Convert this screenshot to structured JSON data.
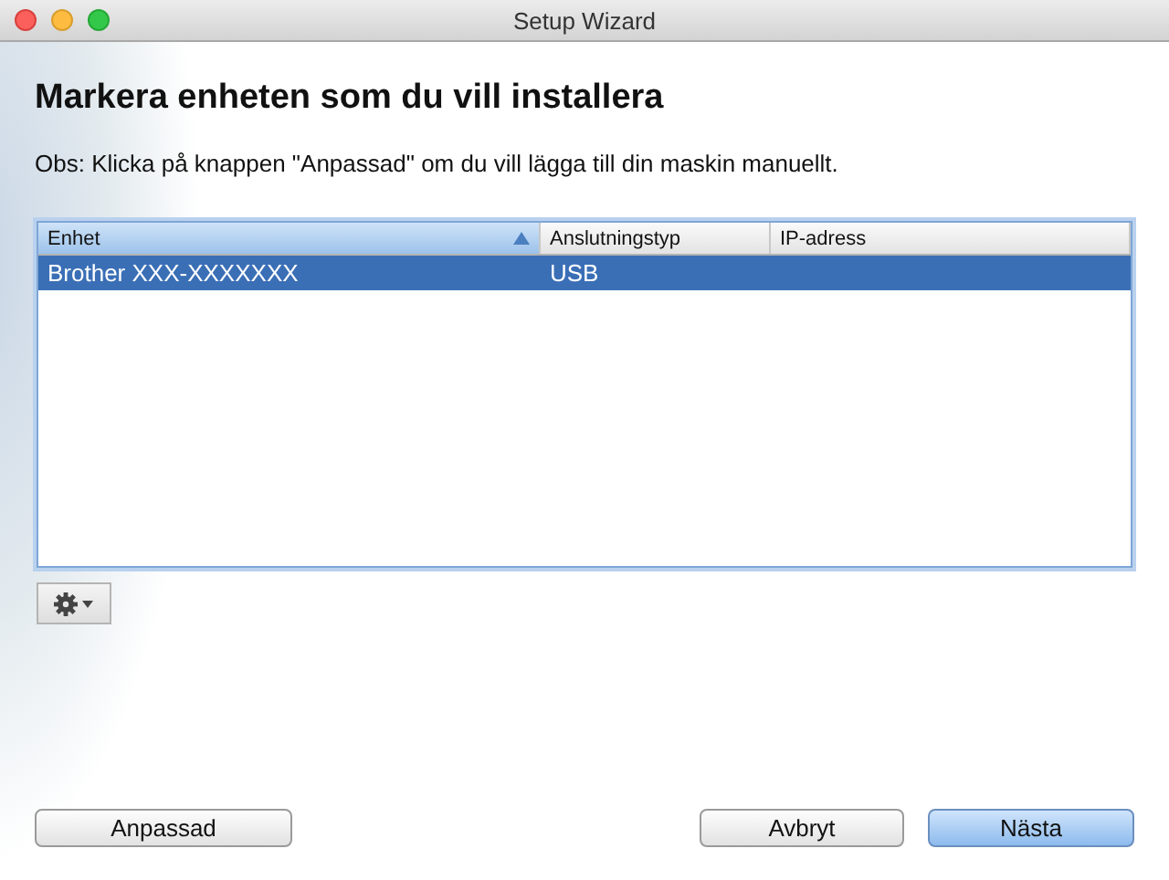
{
  "window": {
    "title": "Setup Wizard"
  },
  "heading": "Markera enheten som du vill installera",
  "note": "Obs: Klicka på knappen \"Anpassad\" om du vill lägga till din maskin manuellt.",
  "table": {
    "columns": [
      {
        "label": "Enhet",
        "sorted": true
      },
      {
        "label": "Anslutningstyp",
        "sorted": false
      },
      {
        "label": "IP-adress",
        "sorted": false
      }
    ],
    "rows": [
      {
        "cells": [
          "Brother XXX-XXXXXXX",
          "USB"
        ],
        "selected": true
      }
    ]
  },
  "buttons": [
    {
      "label": "Anpassad",
      "default": false
    },
    {
      "label": "Avbryt",
      "default": false
    },
    {
      "label": "Nästa",
      "default": true
    }
  ]
}
